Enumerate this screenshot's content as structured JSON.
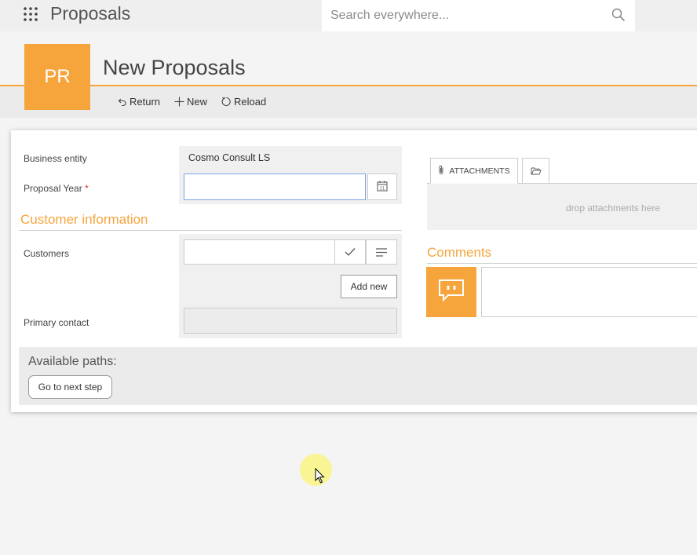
{
  "app": {
    "title": "Proposals"
  },
  "search": {
    "placeholder": "Search everywhere..."
  },
  "header": {
    "tile_text": "PR",
    "title": "New Proposals",
    "toolbar": {
      "return_label": "Return",
      "new_label": "New",
      "reload_label": "Reload"
    }
  },
  "form": {
    "business_entity": {
      "label": "Business entity",
      "value": "Cosmo Consult LS"
    },
    "proposal_year": {
      "label": "Proposal Year",
      "required_mark": "*",
      "value": ""
    },
    "customer_section": {
      "title": "Customer information"
    },
    "customers": {
      "label": "Customers",
      "value": "",
      "add_new_label": "Add new"
    },
    "primary_contact": {
      "label": "Primary contact",
      "value": ""
    }
  },
  "attachments": {
    "tab_label": "ATTACHMENTS",
    "drop_text": "drop attachments here"
  },
  "comments": {
    "title": "Comments"
  },
  "paths": {
    "label": "Available paths:",
    "next_step_label": "Go to next step"
  },
  "colors": {
    "accent": "#f6a53d",
    "focus_border": "#7fa3e6"
  }
}
